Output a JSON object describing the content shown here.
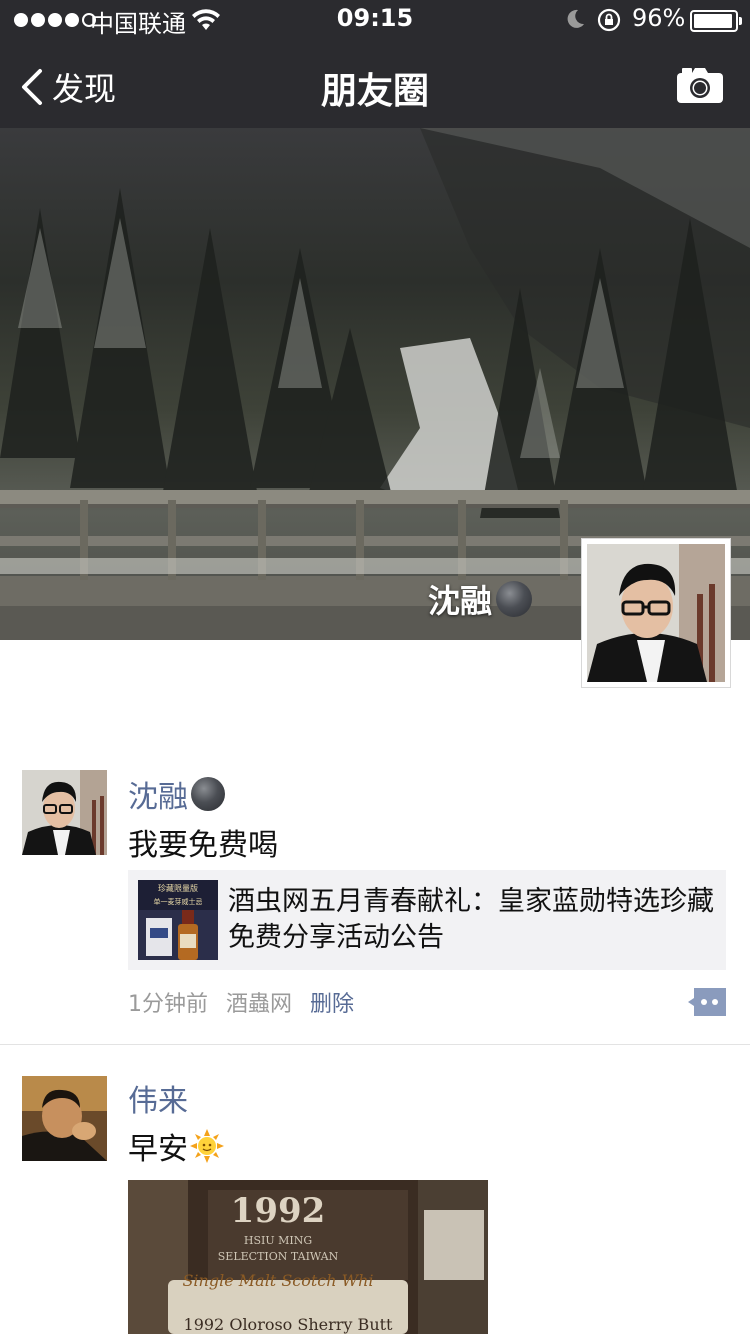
{
  "status_bar": {
    "carrier": "中国联通",
    "time": "09:15",
    "battery": "96%",
    "battery_level": 0.96,
    "signal_bars_filled": 4,
    "signal_bars_total": 5
  },
  "nav": {
    "back_label": "发现",
    "title": "朋友圈"
  },
  "cover": {
    "owner_name": "沈融"
  },
  "posts": [
    {
      "user": "沈融",
      "text": "我要免费喝",
      "link": {
        "thumb_lines": [
          "珍藏限量版",
          "单一麦芽威士忌"
        ],
        "title": "酒虫网五月青春献礼：皇家蓝勋特选珍藏免费分享活动公告"
      },
      "time": "1分钟前",
      "source": "酒蟲网",
      "delete_label": "删除"
    },
    {
      "user": "伟来",
      "text": "早安",
      "photo_lines": {
        "year": "1992",
        "line1": "HSIU MING",
        "line2": "SELECTION TAIWAN",
        "line3": "Single Malt Scotch Whi",
        "line4": "1992 Oloroso Sherry Butt"
      }
    }
  ],
  "colors": {
    "nav_bg": "#2b2b2f",
    "name_blue": "#576b95",
    "card_bg": "#f2f2f4"
  }
}
